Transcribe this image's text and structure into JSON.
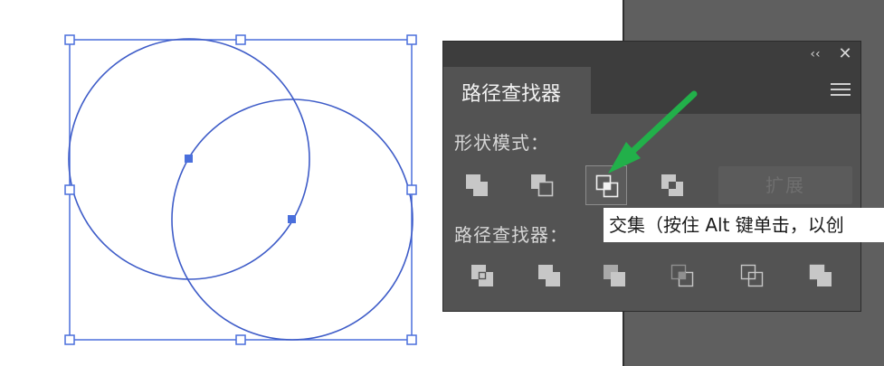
{
  "panel": {
    "collapse_label": "‹‹",
    "close_label": "✕",
    "tab_title": "路径查找器",
    "menu_icon": "hamburger-menu-icon",
    "shape_modes_label": "形状模式：",
    "pathfinders_label": "路径查找器：",
    "expand_label": "扩展",
    "shape_mode_buttons": [
      "unite",
      "minus-front",
      "intersect",
      "exclude"
    ],
    "active_shape_mode": "intersect",
    "pathfinder_buttons": [
      "divide",
      "trim",
      "merge",
      "crop",
      "outline",
      "minus-back"
    ]
  },
  "tooltip": {
    "text": "交集（按住 Alt 键单击，以创"
  },
  "colors": {
    "selection": "#4a6fdc",
    "panel_bg": "#535353",
    "panel_header": "#3d3d3d",
    "arrow": "#22b04a",
    "pasteboard": "#5f5f5f"
  }
}
